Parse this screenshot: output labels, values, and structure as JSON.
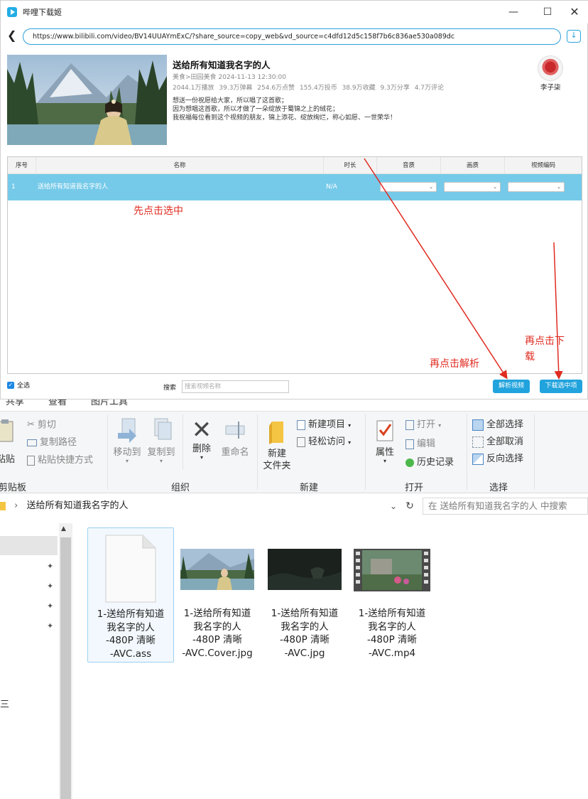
{
  "app": {
    "title": "哔哩下载姬",
    "url": "https://www.bilibili.com/video/BV14UUAYmExC/?share_source=copy_web&vd_source=c4dfd12d5c158f7b6c836ae530a089dc",
    "window_controls": [
      "minimize-icon",
      "maximize-icon",
      "close-icon"
    ]
  },
  "video": {
    "title": "送给所有知道我名字的人",
    "category_date": "美食>田园美食   2024-11-13 12:30:00",
    "stats": [
      "2044.1万播放",
      "39.3万弹幕",
      "254.6万点赞",
      "155.4万投币",
      "38.9万收藏",
      "9.3万分享",
      "4.7万评论"
    ],
    "description": [
      "想送一份祝愿给大家，所以唱了这首歌；",
      "因为想唱这首歌，所以才做了一朵绽放于蜀锦之上的绒花；",
      "我祝福每位看到这个视频的朋友，锦上添花、绽放绚烂，称心如愿、一世荣华！"
    ],
    "uploader": "李子柒"
  },
  "table": {
    "headers": [
      "序号",
      "名称",
      "时长",
      "音质",
      "画质",
      "视频编码"
    ],
    "rows": [
      {
        "index": "1",
        "name": "送给所有知道我名字的人",
        "duration": "N/A",
        "audio": "",
        "quality": "",
        "codec": ""
      }
    ]
  },
  "annotations": {
    "step1": "先点击选中",
    "step2": "再点击解析",
    "step3_line1": "再点击下",
    "step3_line2": "载",
    "color": "#e02b20"
  },
  "bottom": {
    "select_all": "全选",
    "search_label": "搜索",
    "search_placeholder": "搜索视频名称",
    "parse_button": "解析视频",
    "download_button": "下载选中项"
  },
  "explorer": {
    "tabs_partial": [
      "共享",
      "查看",
      "图片工具"
    ],
    "clipboard": {
      "paste": "粘贴",
      "cut": "剪切",
      "copy_path": "复制路径",
      "paste_shortcut": "粘贴快捷方式",
      "label": "剪贴板"
    },
    "organize": {
      "move_to": "移动到",
      "copy_to": "复制到",
      "delete": "删除",
      "rename": "重命名",
      "label": "组织"
    },
    "new": {
      "new_item": "新建项目",
      "easy_access": "轻松访问",
      "new_folder_line1": "新建",
      "new_folder_line2": "文件夹",
      "label": "新建"
    },
    "open": {
      "properties": "属性",
      "open": "打开",
      "edit": "编辑",
      "history": "历史记录",
      "label": "打开"
    },
    "select": {
      "select_all": "全部选择",
      "select_none": "全部取消",
      "invert": "反向选择",
      "label": "选择"
    },
    "path": "送给所有知道我名字的人",
    "search_placeholder": "在 送给所有知道我名字的人 中搜索",
    "nav_glyph": "三",
    "files": [
      {
        "line1": "1-送给所有知道",
        "line2": "我名字的人",
        "line3": "-480P 清晰",
        "line4": "-AVC.ass",
        "kind": "document"
      },
      {
        "line1": "1-送给所有知道",
        "line2": "我名字的人",
        "line3": "-480P 清晰",
        "line4": "-AVC.Cover.jpg",
        "kind": "image"
      },
      {
        "line1": "1-送给所有知道",
        "line2": "我名字的人",
        "line3": "-480P 清晰",
        "line4": "-AVC.jpg",
        "kind": "image-dark"
      },
      {
        "line1": "1-送给所有知道",
        "line2": "我名字的人",
        "line3": "-480P 清晰",
        "line4": "-AVC.mp4",
        "kind": "video"
      }
    ]
  }
}
